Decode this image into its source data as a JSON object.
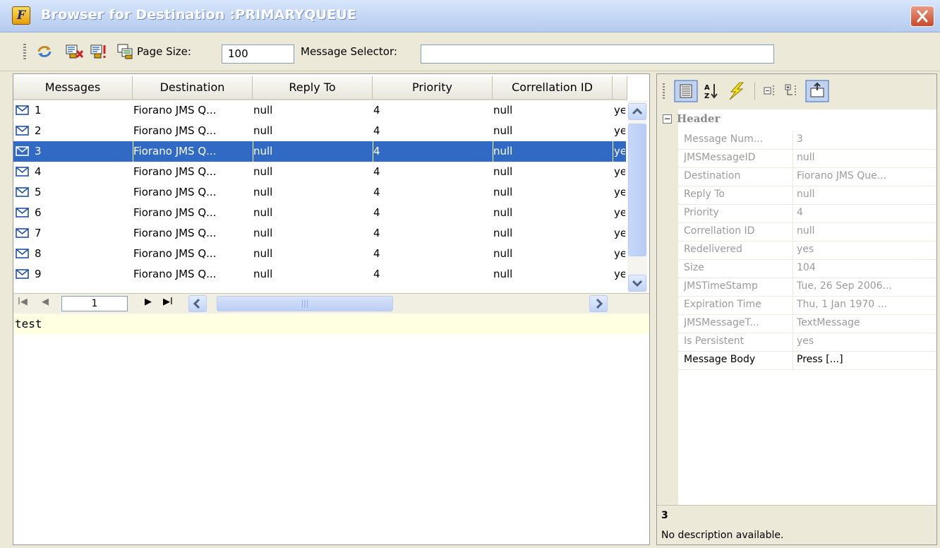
{
  "window": {
    "title": "Browser for Destination :PRIMARYQUEUE",
    "app_icon_letter": "F"
  },
  "toolbar": {
    "page_size_label": "Page Size:",
    "page_size_value": "100",
    "message_selector_label": "Message Selector:",
    "message_selector_value": "",
    "icons": [
      "refresh-icon",
      "delete-message-icon",
      "send-message-icon",
      "copy-message-icon"
    ]
  },
  "table": {
    "columns": [
      "Messages",
      "Destination",
      "Reply To",
      "Priority",
      "Correllation ID"
    ],
    "selected_index": 2,
    "rows": [
      {
        "id": "1",
        "destination": "Fiorano JMS Q...",
        "reply_to": "null",
        "priority": "4",
        "correlation": "null",
        "extra": "ye"
      },
      {
        "id": "2",
        "destination": "Fiorano JMS Q...",
        "reply_to": "null",
        "priority": "4",
        "correlation": "null",
        "extra": "ye"
      },
      {
        "id": "3",
        "destination": "Fiorano JMS Q...",
        "reply_to": "null",
        "priority": "4",
        "correlation": "null",
        "extra": "ye"
      },
      {
        "id": "4",
        "destination": "Fiorano JMS Q...",
        "reply_to": "null",
        "priority": "4",
        "correlation": "null",
        "extra": "ye"
      },
      {
        "id": "5",
        "destination": "Fiorano JMS Q...",
        "reply_to": "null",
        "priority": "4",
        "correlation": "null",
        "extra": "ye"
      },
      {
        "id": "6",
        "destination": "Fiorano JMS Q...",
        "reply_to": "null",
        "priority": "4",
        "correlation": "null",
        "extra": "ye"
      },
      {
        "id": "7",
        "destination": "Fiorano JMS Q...",
        "reply_to": "null",
        "priority": "4",
        "correlation": "null",
        "extra": "ye"
      },
      {
        "id": "8",
        "destination": "Fiorano JMS Q...",
        "reply_to": "null",
        "priority": "4",
        "correlation": "null",
        "extra": "ye"
      },
      {
        "id": "9",
        "destination": "Fiorano JMS Q...",
        "reply_to": "null",
        "priority": "4",
        "correlation": "null",
        "extra": "ye"
      }
    ]
  },
  "pager": {
    "first": "I◀",
    "prev": "◀",
    "page": "1",
    "next": "▶",
    "last": "▶I"
  },
  "message_body": "test",
  "properties": {
    "category": "Header",
    "collapse_symbol": "−",
    "rows": [
      {
        "name": "Message Num...",
        "value": "3"
      },
      {
        "name": "JMSMessageID",
        "value": "null"
      },
      {
        "name": "Destination",
        "value": "Fiorano JMS Que..."
      },
      {
        "name": "Reply To",
        "value": "null"
      },
      {
        "name": "Priority",
        "value": "4"
      },
      {
        "name": "Correllation ID",
        "value": "null"
      },
      {
        "name": "Redelivered",
        "value": "yes"
      },
      {
        "name": "Size",
        "value": "104"
      },
      {
        "name": "JMSTimeStamp",
        "value": "Tue, 26 Sep 2006..."
      },
      {
        "name": "Expiration Time",
        "value": "Thu, 1 Jan 1970 ..."
      },
      {
        "name": "JMSMessageT...",
        "value": "TextMessage"
      },
      {
        "name": "Is Persistent",
        "value": "yes"
      },
      {
        "name": "Message Body",
        "value": "Press [...]"
      }
    ],
    "active_index": 12,
    "description_title": "3",
    "description_text": "No description available."
  },
  "colors": {
    "selection": "#316ac5",
    "body_background": "#ffffe1",
    "titlebar": "#c6d9f5"
  }
}
